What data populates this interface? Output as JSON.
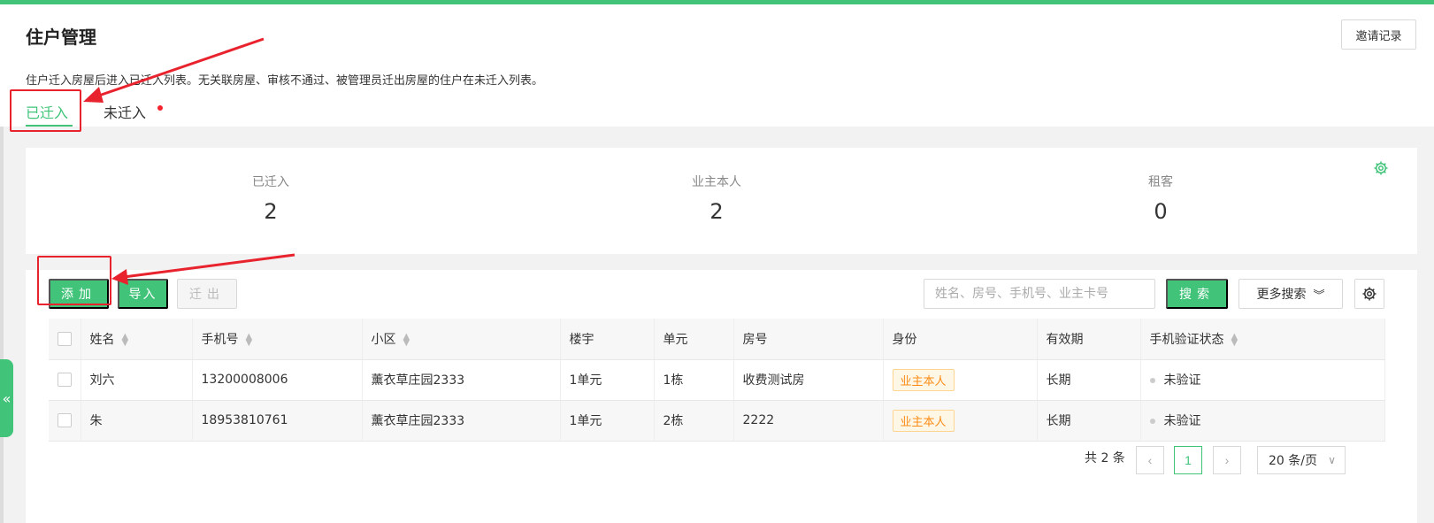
{
  "page": {
    "title": "住户管理",
    "invite_button": "邀请记录",
    "description": "住户迁入房屋后进入已迁入列表。无关联房屋、审核不通过、被管理员迁出房屋的住户在未迁入列表。"
  },
  "tabs": [
    {
      "label": "已迁入",
      "active": true
    },
    {
      "label": "未迁入",
      "active": false,
      "has_dot": true
    }
  ],
  "stats": [
    {
      "label": "已迁入",
      "value": "2"
    },
    {
      "label": "业主本人",
      "value": "2"
    },
    {
      "label": "租客",
      "value": "0"
    }
  ],
  "toolbar": {
    "add": "添加",
    "import": "导入",
    "move_out": "迁出",
    "search_placeholder": "姓名、房号、手机号、业主卡号",
    "search": "搜索",
    "more_search": "更多搜索"
  },
  "table": {
    "columns": [
      "姓名",
      "手机号",
      "小区",
      "楼宇",
      "单元",
      "房号",
      "身份",
      "有效期",
      "手机验证状态"
    ],
    "rows": [
      {
        "name": "刘六",
        "phone": "13200008006",
        "community": "薰衣草庄园2333",
        "building": "1单元",
        "unit": "1栋",
        "room": "收费测试房",
        "identity": "业主本人",
        "validity": "长期",
        "verify": "未验证"
      },
      {
        "name": "朱",
        "phone": "18953810761",
        "community": "薰衣草庄园2333",
        "building": "1单元",
        "unit": "2栋",
        "room": "2222",
        "identity": "业主本人",
        "validity": "长期",
        "verify": "未验证"
      }
    ]
  },
  "pagination": {
    "total": "共 2 条",
    "current_page": "1",
    "page_size": "20 条/页"
  },
  "colors": {
    "accent": "#41c47a",
    "annotation": "#e8232e",
    "badge": "#fa8c16"
  },
  "icons": {
    "collapse": "double-chevron-left-icon",
    "settings": "gear-icon"
  }
}
